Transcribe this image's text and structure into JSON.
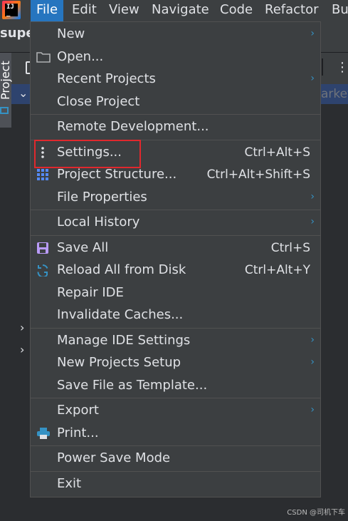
{
  "menubar": {
    "items": [
      {
        "label": "File",
        "active": true
      },
      {
        "label": "Edit"
      },
      {
        "label": "View"
      },
      {
        "label": "Navigate"
      },
      {
        "label": "Code"
      },
      {
        "label": "Refactor"
      },
      {
        "label": "Bu"
      }
    ],
    "accent": "#2675bf"
  },
  "background": {
    "project_name": "supe",
    "tool_label": "Project",
    "market_text": "arket",
    "watermark": "CSDN @司机下车"
  },
  "file_menu": {
    "groups": [
      [
        {
          "label": "New",
          "submenu": true,
          "icon": ""
        },
        {
          "label": "Open...",
          "icon": "folder-icon"
        },
        {
          "label": "Recent Projects",
          "submenu": true
        },
        {
          "label": "Close Project"
        }
      ],
      [
        {
          "label": "Remote Development..."
        }
      ],
      [
        {
          "label": "Settings...",
          "shortcut": "Ctrl+Alt+S",
          "icon": "more-vertical-icon",
          "highlighted": true
        },
        {
          "label": "Project Structure...",
          "shortcut": "Ctrl+Alt+Shift+S",
          "icon": "grid-icon"
        },
        {
          "label": "File Properties",
          "submenu": true
        }
      ],
      [
        {
          "label": "Local History",
          "submenu": true
        }
      ],
      [
        {
          "label": "Save All",
          "shortcut": "Ctrl+S",
          "icon": "save-icon"
        },
        {
          "label": "Reload All from Disk",
          "shortcut": "Ctrl+Alt+Y",
          "icon": "reload-icon"
        },
        {
          "label": "Repair IDE"
        },
        {
          "label": "Invalidate Caches..."
        }
      ],
      [
        {
          "label": "Manage IDE Settings",
          "submenu": true
        },
        {
          "label": "New Projects Setup",
          "submenu": true
        },
        {
          "label": "Save File as Template..."
        }
      ],
      [
        {
          "label": "Export",
          "submenu": true
        },
        {
          "label": "Print...",
          "icon": "print-icon"
        }
      ],
      [
        {
          "label": "Power Save Mode"
        }
      ],
      [
        {
          "label": "Exit"
        }
      ]
    ]
  },
  "colors": {
    "highlight_border": "#e0282d",
    "submenu_arrow": "#3592c4"
  }
}
